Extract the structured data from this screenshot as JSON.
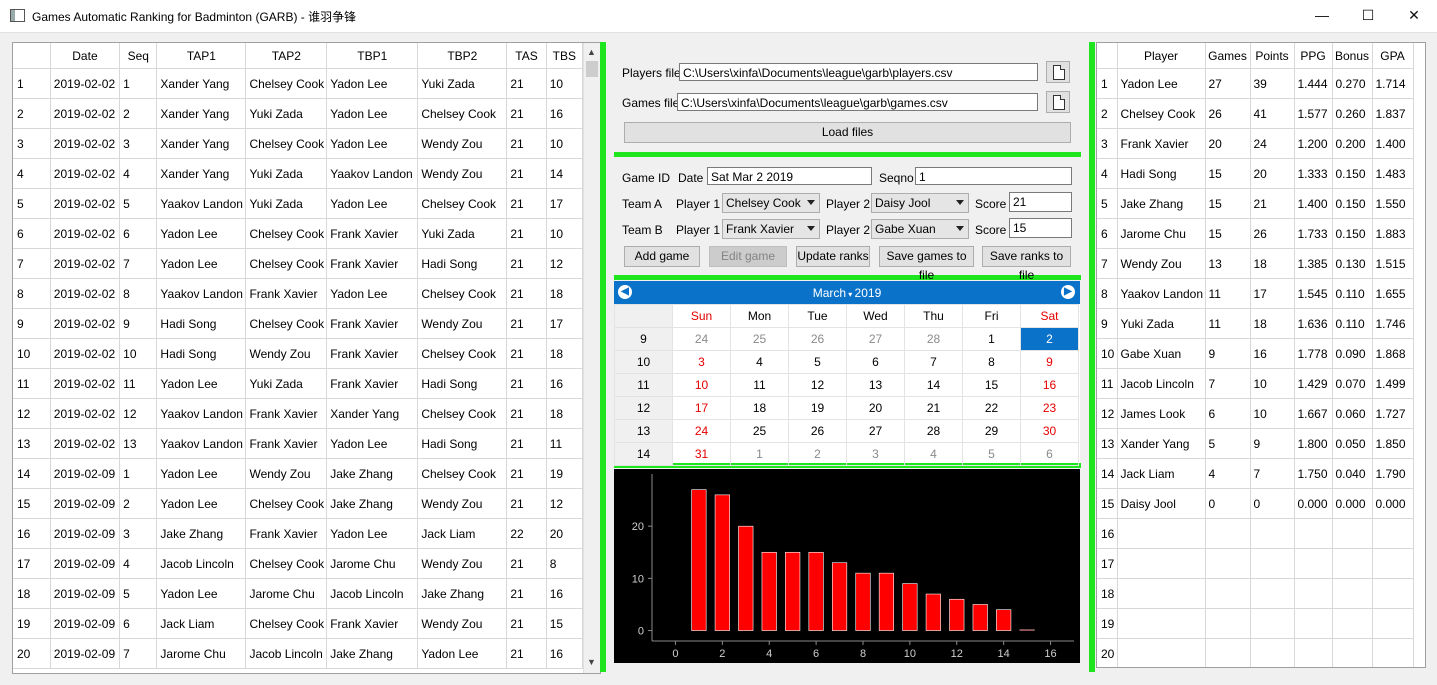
{
  "window": {
    "title": "Games Automatic Ranking for Badminton (GARB) - 谁羽争锋",
    "minimize": "—",
    "maximize": "☐",
    "close": "✕"
  },
  "games_table": {
    "columns": [
      "",
      "Date",
      "Seq",
      "TAP1",
      "TAP2",
      "TBP1",
      "TBP2",
      "TAS",
      "TBS"
    ],
    "rows": [
      [
        "1",
        "2019-02-02",
        "1",
        "Xander Yang",
        "Chelsey Cook",
        "Yadon Lee",
        "Yuki Zada",
        "21",
        "10"
      ],
      [
        "2",
        "2019-02-02",
        "2",
        "Xander Yang",
        "Yuki Zada",
        "Yadon Lee",
        "Chelsey Cook",
        "21",
        "16"
      ],
      [
        "3",
        "2019-02-02",
        "3",
        "Xander Yang",
        "Chelsey Cook",
        "Yadon Lee",
        "Wendy Zou",
        "21",
        "10"
      ],
      [
        "4",
        "2019-02-02",
        "4",
        "Xander Yang",
        "Yuki Zada",
        "Yaakov Landon",
        "Wendy Zou",
        "21",
        "14"
      ],
      [
        "5",
        "2019-02-02",
        "5",
        "Yaakov Landon",
        "Yuki Zada",
        "Yadon Lee",
        "Chelsey Cook",
        "21",
        "17"
      ],
      [
        "6",
        "2019-02-02",
        "6",
        "Yadon Lee",
        "Chelsey Cook",
        "Frank Xavier",
        "Yuki Zada",
        "21",
        "10"
      ],
      [
        "7",
        "2019-02-02",
        "7",
        "Yadon Lee",
        "Chelsey Cook",
        "Frank Xavier",
        "Hadi Song",
        "21",
        "12"
      ],
      [
        "8",
        "2019-02-02",
        "8",
        "Yaakov Landon",
        "Frank Xavier",
        "Yadon Lee",
        "Chelsey Cook",
        "21",
        "18"
      ],
      [
        "9",
        "2019-02-02",
        "9",
        "Hadi Song",
        "Chelsey Cook",
        "Frank Xavier",
        "Wendy Zou",
        "21",
        "17"
      ],
      [
        "10",
        "2019-02-02",
        "10",
        "Hadi Song",
        "Wendy Zou",
        "Frank Xavier",
        "Chelsey Cook",
        "21",
        "18"
      ],
      [
        "11",
        "2019-02-02",
        "11",
        "Yadon Lee",
        "Yuki Zada",
        "Frank Xavier",
        "Hadi Song",
        "21",
        "16"
      ],
      [
        "12",
        "2019-02-02",
        "12",
        "Yaakov Landon",
        "Frank Xavier",
        "Xander Yang",
        "Chelsey Cook",
        "21",
        "18"
      ],
      [
        "13",
        "2019-02-02",
        "13",
        "Yaakov Landon",
        "Frank Xavier",
        "Yadon Lee",
        "Hadi Song",
        "21",
        "11"
      ],
      [
        "14",
        "2019-02-09",
        "1",
        "Yadon Lee",
        "Wendy Zou",
        "Jake Zhang",
        "Chelsey Cook",
        "21",
        "19"
      ],
      [
        "15",
        "2019-02-09",
        "2",
        "Yadon Lee",
        "Chelsey Cook",
        "Jake Zhang",
        "Wendy Zou",
        "21",
        "12"
      ],
      [
        "16",
        "2019-02-09",
        "3",
        "Jake Zhang",
        "Frank Xavier",
        "Yadon Lee",
        "Jack Liam",
        "22",
        "20"
      ],
      [
        "17",
        "2019-02-09",
        "4",
        "Jacob Lincoln",
        "Chelsey Cook",
        "Jarome Chu",
        "Wendy Zou",
        "21",
        "8"
      ],
      [
        "18",
        "2019-02-09",
        "5",
        "Yadon Lee",
        "Jarome Chu",
        "Jacob Lincoln",
        "Jake Zhang",
        "21",
        "16"
      ],
      [
        "19",
        "2019-02-09",
        "6",
        "Jack Liam",
        "Chelsey Cook",
        "Frank Xavier",
        "Wendy Zou",
        "21",
        "15"
      ],
      [
        "20",
        "2019-02-09",
        "7",
        "Jarome Chu",
        "Jacob Lincoln",
        "Jake Zhang",
        "Yadon Lee",
        "21",
        "16"
      ]
    ]
  },
  "files": {
    "players_label": "Players file",
    "players_path": "C:\\Users\\xinfa\\Documents\\league\\garb\\players.csv",
    "games_label": "Games file",
    "games_path": "C:\\Users\\xinfa\\Documents\\league\\garb\\games.csv",
    "load_button": "Load files"
  },
  "game_form": {
    "game_id_label": "Game ID",
    "date_label": "Date",
    "date_value": "Sat Mar 2 2019",
    "seqno_label": "Seqno",
    "seqno_value": "1",
    "team_a_label": "Team A",
    "team_b_label": "Team B",
    "player1_label": "Player 1",
    "player2_label": "Player 2",
    "score_label": "Score",
    "team_a_p1": "Chelsey Cook",
    "team_a_p2": "Daisy Jool",
    "team_a_score": "21",
    "team_b_p1": "Frank Xavier",
    "team_b_p2": "Gabe Xuan",
    "team_b_score": "15",
    "add_game": "Add game",
    "edit_game": "Edit game",
    "update_ranks": "Update ranks",
    "save_games": "Save games to file",
    "save_ranks": "Save ranks to file"
  },
  "calendar": {
    "month": "March",
    "year": "2019",
    "weekdays": [
      "Sun",
      "Mon",
      "Tue",
      "Wed",
      "Thu",
      "Fri",
      "Sat"
    ],
    "weeks": [
      {
        "wk": "9",
        "days": [
          "24",
          "25",
          "26",
          "27",
          "28",
          "1",
          "2"
        ]
      },
      {
        "wk": "10",
        "days": [
          "3",
          "4",
          "5",
          "6",
          "7",
          "8",
          "9"
        ]
      },
      {
        "wk": "11",
        "days": [
          "10",
          "11",
          "12",
          "13",
          "14",
          "15",
          "16"
        ]
      },
      {
        "wk": "12",
        "days": [
          "17",
          "18",
          "19",
          "20",
          "21",
          "22",
          "23"
        ]
      },
      {
        "wk": "13",
        "days": [
          "24",
          "25",
          "26",
          "27",
          "28",
          "29",
          "30"
        ]
      },
      {
        "wk": "14",
        "days": [
          "31",
          "1",
          "2",
          "3",
          "4",
          "5",
          "6"
        ]
      }
    ],
    "selected": "2",
    "accent_color": "#0a73c9",
    "weekend_color": "#e50000"
  },
  "chart_data": {
    "type": "bar",
    "x": [
      1,
      2,
      3,
      4,
      5,
      6,
      7,
      8,
      9,
      10,
      11,
      12,
      13,
      14,
      15
    ],
    "values": [
      27,
      26,
      20,
      15,
      15,
      15,
      13,
      11,
      11,
      9,
      7,
      6,
      5,
      4,
      0
    ],
    "xticks": [
      0,
      2,
      4,
      6,
      8,
      10,
      12,
      14,
      16
    ],
    "yticks": [
      0,
      10,
      20
    ],
    "xlim": [
      -1,
      17
    ],
    "ylim": [
      -2,
      30
    ],
    "bar_color": "#ff0000",
    "background": "#000000"
  },
  "ranks_table": {
    "columns": [
      "",
      "Player",
      "Games",
      "Points",
      "PPG",
      "Bonus",
      "GPA"
    ],
    "rows": [
      [
        "1",
        "Yadon Lee",
        "27",
        "39",
        "1.444",
        "0.270",
        "1.714"
      ],
      [
        "2",
        "Chelsey Cook",
        "26",
        "41",
        "1.577",
        "0.260",
        "1.837"
      ],
      [
        "3",
        "Frank Xavier",
        "20",
        "24",
        "1.200",
        "0.200",
        "1.400"
      ],
      [
        "4",
        "Hadi Song",
        "15",
        "20",
        "1.333",
        "0.150",
        "1.483"
      ],
      [
        "5",
        "Jake Zhang",
        "15",
        "21",
        "1.400",
        "0.150",
        "1.550"
      ],
      [
        "6",
        "Jarome Chu",
        "15",
        "26",
        "1.733",
        "0.150",
        "1.883"
      ],
      [
        "7",
        "Wendy Zou",
        "13",
        "18",
        "1.385",
        "0.130",
        "1.515"
      ],
      [
        "8",
        "Yaakov Landon",
        "11",
        "17",
        "1.545",
        "0.110",
        "1.655"
      ],
      [
        "9",
        "Yuki Zada",
        "11",
        "18",
        "1.636",
        "0.110",
        "1.746"
      ],
      [
        "10",
        "Gabe Xuan",
        "9",
        "16",
        "1.778",
        "0.090",
        "1.868"
      ],
      [
        "11",
        "Jacob Lincoln",
        "7",
        "10",
        "1.429",
        "0.070",
        "1.499"
      ],
      [
        "12",
        "James Look",
        "6",
        "10",
        "1.667",
        "0.060",
        "1.727"
      ],
      [
        "13",
        "Xander Yang",
        "5",
        "9",
        "1.800",
        "0.050",
        "1.850"
      ],
      [
        "14",
        "Jack Liam",
        "4",
        "7",
        "1.750",
        "0.040",
        "1.790"
      ],
      [
        "15",
        "Daisy Jool",
        "0",
        "0",
        "0.000",
        "0.000",
        "0.000"
      ],
      [
        "16",
        "",
        "",
        "",
        "",
        "",
        ""
      ],
      [
        "17",
        "",
        "",
        "",
        "",
        "",
        ""
      ],
      [
        "18",
        "",
        "",
        "",
        "",
        "",
        ""
      ],
      [
        "19",
        "",
        "",
        "",
        "",
        "",
        ""
      ],
      [
        "20",
        "",
        "",
        "",
        "",
        "",
        ""
      ]
    ]
  }
}
